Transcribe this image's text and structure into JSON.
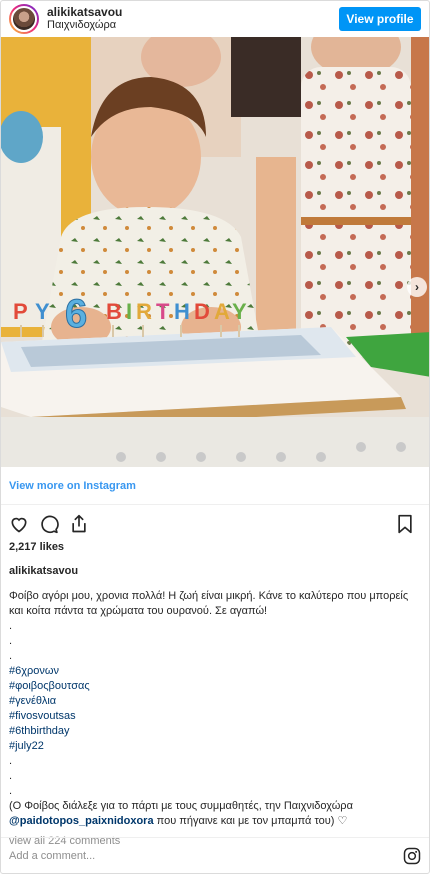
{
  "header": {
    "username": "alikikatsavou",
    "location": "Παιχνιδοχώρα",
    "view_profile_label": "View profile"
  },
  "photo": {
    "candle_number": "6",
    "candle_letters": [
      "P",
      "Y",
      "B",
      "I",
      "R",
      "T",
      "H",
      "D",
      "A",
      "Y"
    ]
  },
  "view_more_label": "View more on Instagram",
  "likes": "2,217 likes",
  "caption": {
    "username": "alikikatsavou",
    "text": "Φοίβο αγόρι μου, χρονια πολλά! Η ζωή είναι μικρή. Κάνε το καλύτερο που μπορείς και κοίτα πάντα τα χρώματα του ουρανού. Σε αγαπώ!",
    "dots_before": [
      ".",
      ".",
      "."
    ],
    "hashtags": [
      "#6χρονων",
      "#φοιβοςβουτσας",
      "#γενέθλια",
      "#fivosvoutsas",
      "#6thbirthday",
      "#july22"
    ],
    "dots_after": [
      ".",
      ".",
      "."
    ],
    "closing_start": "(Ο Φοίβος διάλεξε για το πάρτι με τους συμμαθητές, την Παιχνιδοχώρα",
    "mention": "@paidotopos_paixnidoxora",
    "closing_end": "που πήγαινε και με τον μπαμπά του) ♡"
  },
  "view_comments_label": "view all 224 comments",
  "comment_placeholder": "Add a comment...",
  "icons": {
    "like": "heart-icon",
    "comment": "comment-icon",
    "share": "share-icon",
    "save": "bookmark-icon",
    "instagram": "instagram-icon",
    "next": "chevron-right-icon"
  },
  "colors": {
    "primary_button": "#0095f6",
    "link": "#3897f0",
    "hashtag": "#00376b",
    "muted": "#8e8e8e"
  }
}
